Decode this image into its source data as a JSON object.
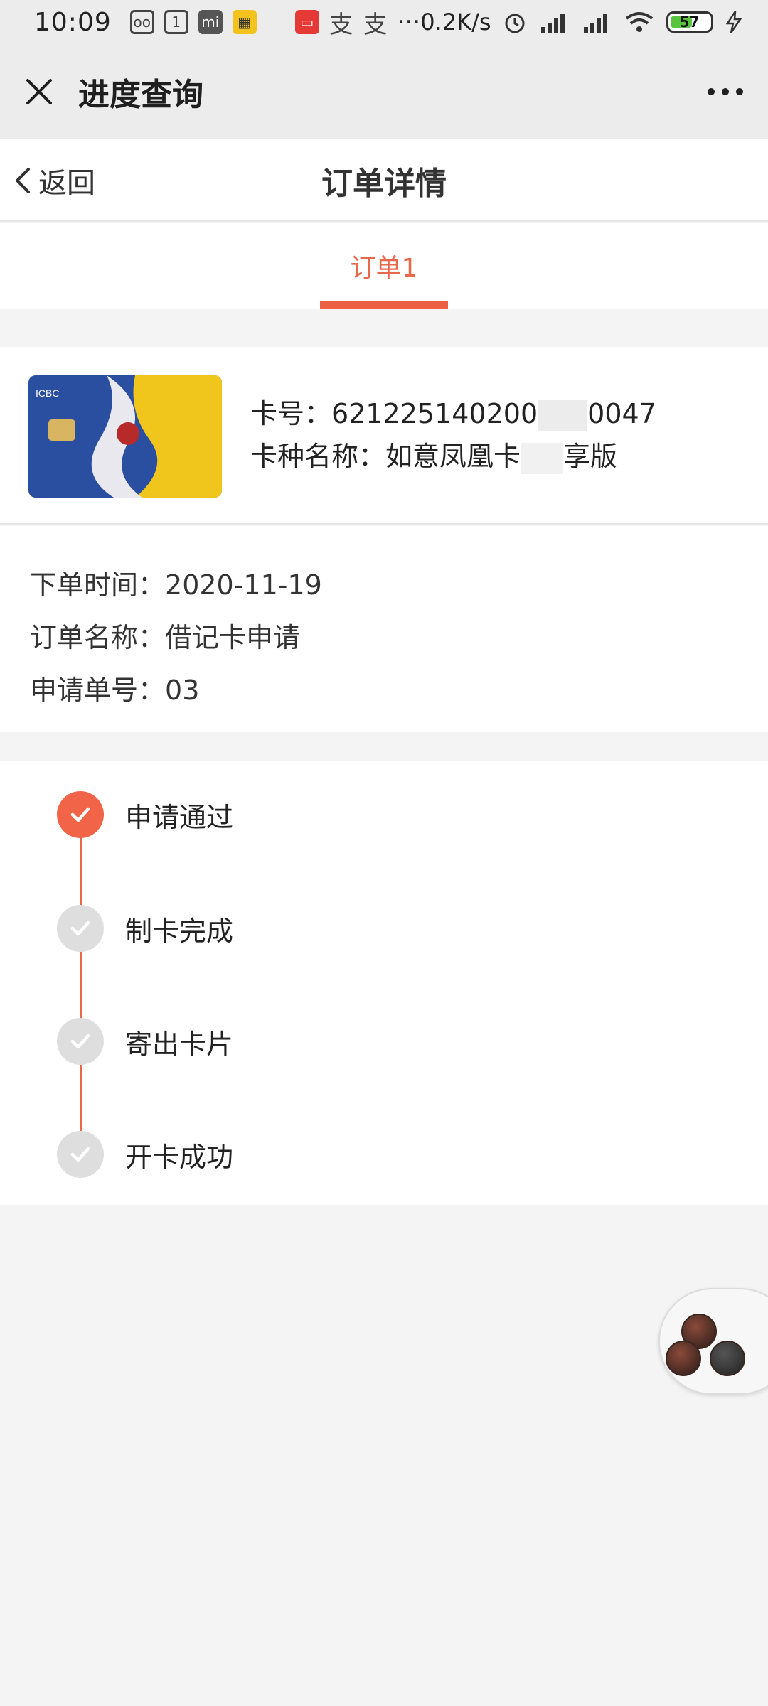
{
  "status_bar": {
    "time": "10:09",
    "net_speed": "0.2K/s",
    "battery": "57",
    "battery_fraction": 0.57,
    "icons": [
      "voicemail-icon",
      "calendar-icon",
      "mi-icon",
      "app-icon",
      "bank-app-icon",
      "alipay-icon",
      "alipay-icon",
      "more-notifications-icon",
      "alarm-icon",
      "signal-icon",
      "signal-icon",
      "wifi-icon",
      "battery-icon",
      "charging-icon"
    ]
  },
  "app_header": {
    "title": "进度查询"
  },
  "sub_header": {
    "back_label": "返回",
    "title": "订单详情"
  },
  "tabs": [
    {
      "label": "订单1",
      "active": true
    }
  ],
  "card": {
    "number_label": "卡号：",
    "number_value": "621225140200",
    "number_tail": "0047",
    "type_label": "卡种名称：",
    "type_value": "如意凤凰卡",
    "type_tail": "享版"
  },
  "order": {
    "time_label": "下单时间：",
    "time_value": "2020-11-19",
    "name_label": "订单名称：",
    "name_value": "借记卡申请",
    "number_label": "申请单号：",
    "number_value": "03"
  },
  "progress": {
    "steps": [
      {
        "label": "申请通过",
        "done": true
      },
      {
        "label": "制卡完成",
        "done": false
      },
      {
        "label": "寄出卡片",
        "done": false
      },
      {
        "label": "开卡成功",
        "done": false
      }
    ]
  },
  "colors": {
    "accent": "#ec6145",
    "pending": "#dedede",
    "header_bg": "#ececec",
    "page_bg": "#f4f4f4"
  }
}
